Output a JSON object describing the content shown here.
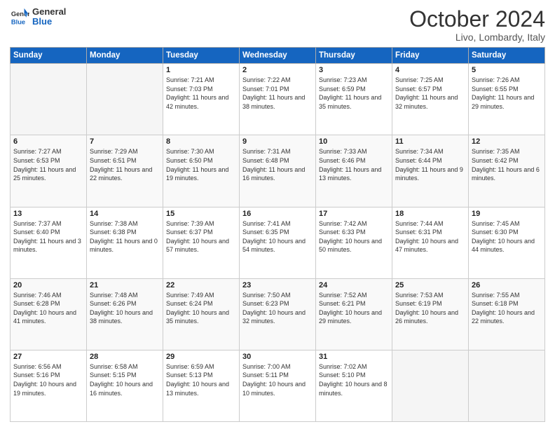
{
  "logo": {
    "line1": "General",
    "line2": "Blue"
  },
  "title": "October 2024",
  "subtitle": "Livo, Lombardy, Italy",
  "weekdays": [
    "Sunday",
    "Monday",
    "Tuesday",
    "Wednesday",
    "Thursday",
    "Friday",
    "Saturday"
  ],
  "weeks": [
    [
      {
        "day": "",
        "detail": ""
      },
      {
        "day": "",
        "detail": ""
      },
      {
        "day": "1",
        "detail": "Sunrise: 7:21 AM\nSunset: 7:03 PM\nDaylight: 11 hours and 42 minutes."
      },
      {
        "day": "2",
        "detail": "Sunrise: 7:22 AM\nSunset: 7:01 PM\nDaylight: 11 hours and 38 minutes."
      },
      {
        "day": "3",
        "detail": "Sunrise: 7:23 AM\nSunset: 6:59 PM\nDaylight: 11 hours and 35 minutes."
      },
      {
        "day": "4",
        "detail": "Sunrise: 7:25 AM\nSunset: 6:57 PM\nDaylight: 11 hours and 32 minutes."
      },
      {
        "day": "5",
        "detail": "Sunrise: 7:26 AM\nSunset: 6:55 PM\nDaylight: 11 hours and 29 minutes."
      }
    ],
    [
      {
        "day": "6",
        "detail": "Sunrise: 7:27 AM\nSunset: 6:53 PM\nDaylight: 11 hours and 25 minutes."
      },
      {
        "day": "7",
        "detail": "Sunrise: 7:29 AM\nSunset: 6:51 PM\nDaylight: 11 hours and 22 minutes."
      },
      {
        "day": "8",
        "detail": "Sunrise: 7:30 AM\nSunset: 6:50 PM\nDaylight: 11 hours and 19 minutes."
      },
      {
        "day": "9",
        "detail": "Sunrise: 7:31 AM\nSunset: 6:48 PM\nDaylight: 11 hours and 16 minutes."
      },
      {
        "day": "10",
        "detail": "Sunrise: 7:33 AM\nSunset: 6:46 PM\nDaylight: 11 hours and 13 minutes."
      },
      {
        "day": "11",
        "detail": "Sunrise: 7:34 AM\nSunset: 6:44 PM\nDaylight: 11 hours and 9 minutes."
      },
      {
        "day": "12",
        "detail": "Sunrise: 7:35 AM\nSunset: 6:42 PM\nDaylight: 11 hours and 6 minutes."
      }
    ],
    [
      {
        "day": "13",
        "detail": "Sunrise: 7:37 AM\nSunset: 6:40 PM\nDaylight: 11 hours and 3 minutes."
      },
      {
        "day": "14",
        "detail": "Sunrise: 7:38 AM\nSunset: 6:38 PM\nDaylight: 11 hours and 0 minutes."
      },
      {
        "day": "15",
        "detail": "Sunrise: 7:39 AM\nSunset: 6:37 PM\nDaylight: 10 hours and 57 minutes."
      },
      {
        "day": "16",
        "detail": "Sunrise: 7:41 AM\nSunset: 6:35 PM\nDaylight: 10 hours and 54 minutes."
      },
      {
        "day": "17",
        "detail": "Sunrise: 7:42 AM\nSunset: 6:33 PM\nDaylight: 10 hours and 50 minutes."
      },
      {
        "day": "18",
        "detail": "Sunrise: 7:44 AM\nSunset: 6:31 PM\nDaylight: 10 hours and 47 minutes."
      },
      {
        "day": "19",
        "detail": "Sunrise: 7:45 AM\nSunset: 6:30 PM\nDaylight: 10 hours and 44 minutes."
      }
    ],
    [
      {
        "day": "20",
        "detail": "Sunrise: 7:46 AM\nSunset: 6:28 PM\nDaylight: 10 hours and 41 minutes."
      },
      {
        "day": "21",
        "detail": "Sunrise: 7:48 AM\nSunset: 6:26 PM\nDaylight: 10 hours and 38 minutes."
      },
      {
        "day": "22",
        "detail": "Sunrise: 7:49 AM\nSunset: 6:24 PM\nDaylight: 10 hours and 35 minutes."
      },
      {
        "day": "23",
        "detail": "Sunrise: 7:50 AM\nSunset: 6:23 PM\nDaylight: 10 hours and 32 minutes."
      },
      {
        "day": "24",
        "detail": "Sunrise: 7:52 AM\nSunset: 6:21 PM\nDaylight: 10 hours and 29 minutes."
      },
      {
        "day": "25",
        "detail": "Sunrise: 7:53 AM\nSunset: 6:19 PM\nDaylight: 10 hours and 26 minutes."
      },
      {
        "day": "26",
        "detail": "Sunrise: 7:55 AM\nSunset: 6:18 PM\nDaylight: 10 hours and 22 minutes."
      }
    ],
    [
      {
        "day": "27",
        "detail": "Sunrise: 6:56 AM\nSunset: 5:16 PM\nDaylight: 10 hours and 19 minutes."
      },
      {
        "day": "28",
        "detail": "Sunrise: 6:58 AM\nSunset: 5:15 PM\nDaylight: 10 hours and 16 minutes."
      },
      {
        "day": "29",
        "detail": "Sunrise: 6:59 AM\nSunset: 5:13 PM\nDaylight: 10 hours and 13 minutes."
      },
      {
        "day": "30",
        "detail": "Sunrise: 7:00 AM\nSunset: 5:11 PM\nDaylight: 10 hours and 10 minutes."
      },
      {
        "day": "31",
        "detail": "Sunrise: 7:02 AM\nSunset: 5:10 PM\nDaylight: 10 hours and 8 minutes."
      },
      {
        "day": "",
        "detail": ""
      },
      {
        "day": "",
        "detail": ""
      }
    ]
  ]
}
